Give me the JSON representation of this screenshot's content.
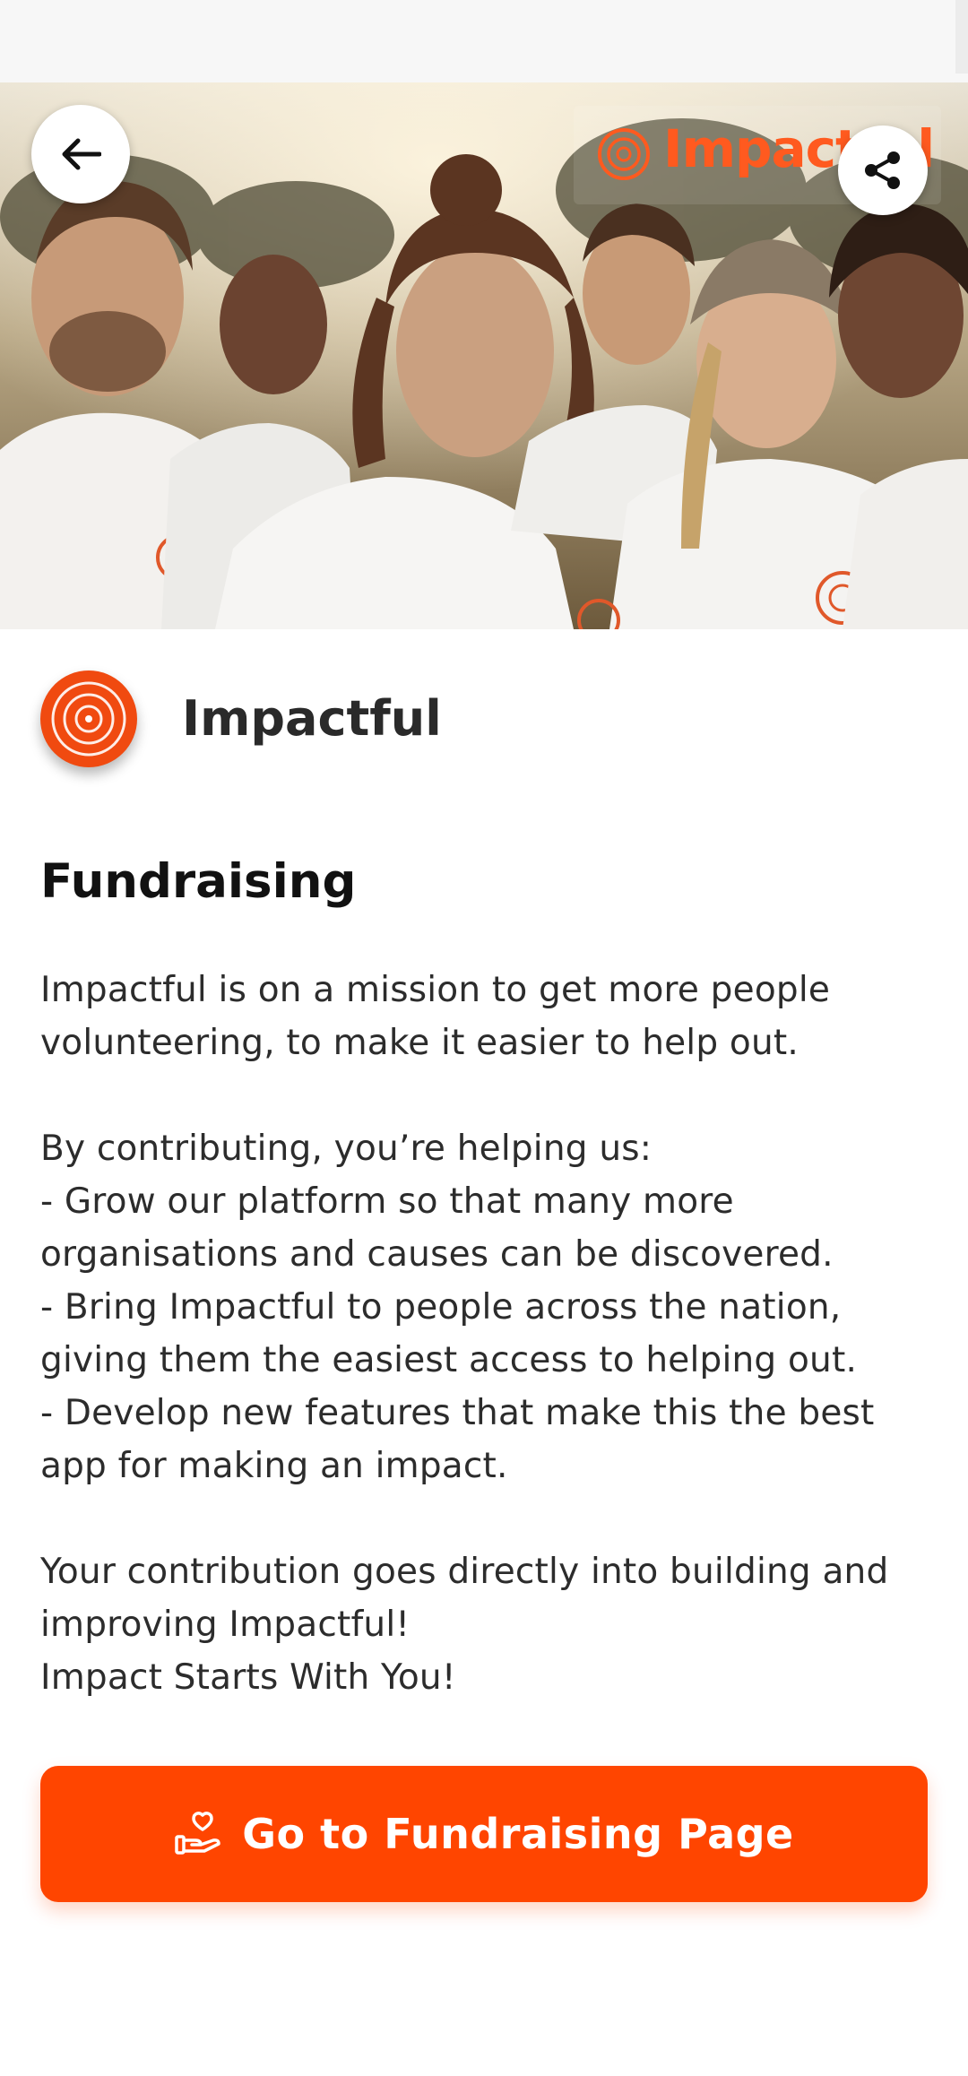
{
  "hero": {
    "brand_badge_text": "Impactful",
    "icons": {
      "back": "arrow-left-icon",
      "share": "share-icon"
    }
  },
  "org": {
    "name": "Impactful",
    "logo_icon": "target-rings-logo-icon"
  },
  "section": {
    "title": "Fundraising",
    "body": "Impactful is on a mission to get more people\nvolunteering, to make it easier to help out.\n\nBy contributing, you’re helping us:\n- Grow our platform so that many more\norganisations and causes can be discovered.\n- Bring Impactful to people across the nation,\ngiving them the easiest access to helping out.\n- Develop new features that make this the best\napp for making an impact.\n\nYour contribution goes directly into building and\nimproving Impactful!\nImpact Starts With You!"
  },
  "cta": {
    "label": "Go to Fundraising Page",
    "icon": "hand-heart-icon"
  },
  "colors": {
    "accent": "#ff4500",
    "logo": "#f04a10",
    "text": "#2c2c2c"
  }
}
